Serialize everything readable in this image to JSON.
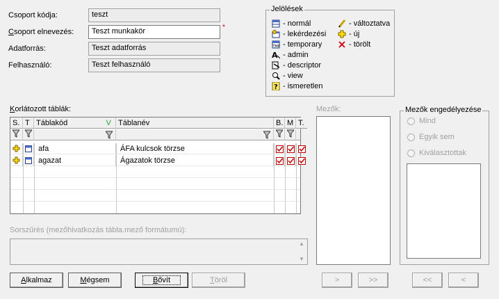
{
  "form": {
    "code_label": "Csoport kódja:",
    "code_value": "teszt",
    "name_label": "Csoport elnevezés:",
    "name_value": "Teszt munkakör",
    "source_label": "Adatforrás:",
    "source_value": "Teszt adatforrás",
    "user_label": "Felhasználó:",
    "user_value": "Teszt felhasználó"
  },
  "legend": {
    "title": "Jelölések",
    "left": [
      {
        "icon": "table-icon",
        "label": "- normál"
      },
      {
        "icon": "lookup-table-icon",
        "label": "- lekérdezési"
      },
      {
        "icon": "temporary-table-icon",
        "label": "- temporary"
      },
      {
        "icon": "admin-icon",
        "label": "- admin"
      },
      {
        "icon": "descriptor-icon",
        "label": "- descriptor"
      },
      {
        "icon": "view-icon",
        "label": "- view"
      },
      {
        "icon": "unknown-icon",
        "label": "- ismeretlen"
      }
    ],
    "right": [
      {
        "icon": "pencil-icon",
        "label": "- változtatva"
      },
      {
        "icon": "plus-icon",
        "label": "- új"
      },
      {
        "icon": "x-icon",
        "label": "- törölt"
      }
    ]
  },
  "tables": {
    "label": "Korlátozott táblák:",
    "headers": {
      "s": "S.",
      "t": "T",
      "code": "Táblakód",
      "code_mark": "V",
      "name": "Táblanév",
      "b": "B.",
      "m": "M",
      "t2": "T."
    },
    "rows": [
      {
        "code": "afa",
        "name": "ÁFA kulcsok törzse"
      },
      {
        "code": "agazat",
        "name": "Ágazatok törzse"
      }
    ]
  },
  "row_filter": {
    "label": "Sorszűrés (mezőhivatkozás tábla.mező formátumú):"
  },
  "fields": {
    "label": "Mezők:"
  },
  "field_permission": {
    "title": "Mezők engedélyezése",
    "options": [
      "Mind",
      "Egyik sem",
      "Kiválasztottak"
    ]
  },
  "buttons": {
    "apply": "Alkalmaz",
    "cancel": "Mégsem",
    "expand": "Bővít",
    "delete": "Töröl",
    "next": ">",
    "next_all": ">>",
    "prev_all": "<<",
    "prev": "<"
  }
}
